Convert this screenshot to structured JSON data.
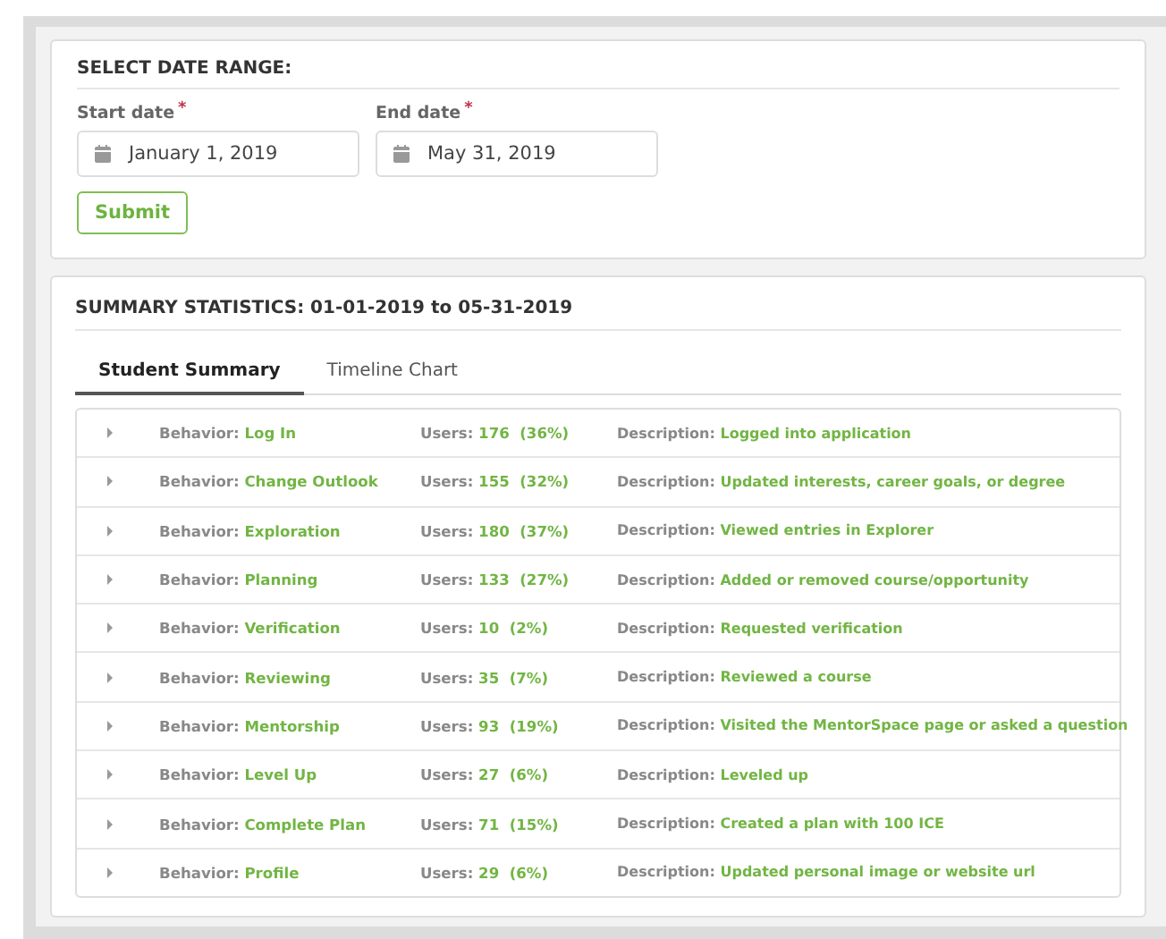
{
  "date_range": {
    "title": "SELECT DATE RANGE:",
    "start": {
      "label": "Start date",
      "required_mark": "*",
      "value": "January 1, 2019"
    },
    "end": {
      "label": "End date",
      "required_mark": "*",
      "value": "May 31, 2019"
    },
    "submit": "Submit"
  },
  "summary": {
    "title": "SUMMARY STATISTICS: 01-01-2019 to 05-31-2019",
    "tabs": [
      {
        "label": "Student Summary",
        "selected": true
      },
      {
        "label": "Timeline Chart",
        "selected": false
      }
    ],
    "rows": [
      {
        "expanded": false,
        "behavior_label": "Behavior:",
        "behavior": "Log In",
        "users_label": "Users:",
        "users": "176",
        "percent": "(36%)",
        "description_label": "Description:",
        "description": "Logged into application"
      },
      {
        "expanded": false,
        "behavior_label": "Behavior:",
        "behavior": "Change Outlook",
        "users_label": "Users:",
        "users": "155",
        "percent": "(32%)",
        "description_label": "Description:",
        "description": "Updated interests, career goals, or degree"
      },
      {
        "expanded": false,
        "behavior_label": "Behavior:",
        "behavior": "Exploration",
        "users_label": "Users:",
        "users": "180",
        "percent": "(37%)",
        "description_label": "Description:",
        "description": "Viewed entries in Explorer"
      },
      {
        "expanded": false,
        "behavior_label": "Behavior:",
        "behavior": "Planning",
        "users_label": "Users:",
        "users": "133",
        "percent": "(27%)",
        "description_label": "Description:",
        "description": "Added or removed course/opportunity"
      },
      {
        "expanded": false,
        "behavior_label": "Behavior:",
        "behavior": "Verification",
        "users_label": "Users:",
        "users": "10",
        "percent": "(2%)",
        "description_label": "Description:",
        "description": "Requested verification"
      },
      {
        "expanded": false,
        "behavior_label": "Behavior:",
        "behavior": "Reviewing",
        "users_label": "Users:",
        "users": "35",
        "percent": "(7%)",
        "description_label": "Description:",
        "description": "Reviewed a course"
      },
      {
        "expanded": false,
        "behavior_label": "Behavior:",
        "behavior": "Mentorship",
        "users_label": "Users:",
        "users": "93",
        "percent": "(19%)",
        "description_label": "Description:",
        "description": "Visited the MentorSpace page or asked a question"
      },
      {
        "expanded": false,
        "behavior_label": "Behavior:",
        "behavior": "Level Up",
        "users_label": "Users:",
        "users": "27",
        "percent": "(6%)",
        "description_label": "Description:",
        "description": "Leveled up"
      },
      {
        "expanded": false,
        "behavior_label": "Behavior:",
        "behavior": "Complete Plan",
        "users_label": "Users:",
        "users": "71",
        "percent": "(15%)",
        "description_label": "Description:",
        "description": "Created a plan with 100 ICE"
      },
      {
        "expanded": false,
        "behavior_label": "Behavior:",
        "behavior": "Profile",
        "users_label": "Users:",
        "users": "29",
        "percent": "(6%)",
        "description_label": "Description:",
        "description": "Updated personal image or website url"
      }
    ]
  }
}
